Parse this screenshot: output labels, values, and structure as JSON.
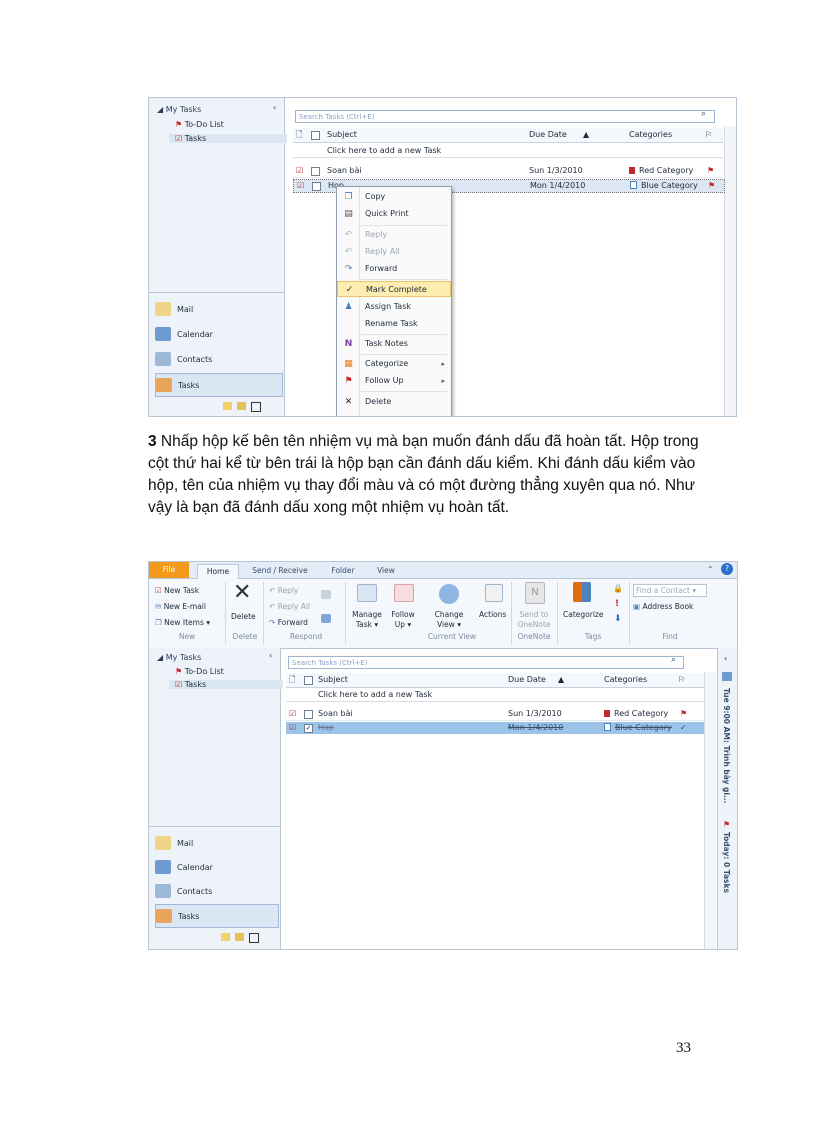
{
  "shot1": {
    "nav": {
      "header": "My Tasks",
      "items": [
        "To-Do List",
        "Tasks"
      ],
      "buttons": [
        "Mail",
        "Calendar",
        "Contacts",
        "Tasks"
      ]
    },
    "search_placeholder": "Search Tasks (Ctrl+E)",
    "columns": {
      "subject": "Subject",
      "due": "Due Date",
      "categories": "Categories"
    },
    "new_task_hint": "Click here to add a new Task",
    "tasks": [
      {
        "subject": "Soan bài",
        "due": "Sun 1/3/2010",
        "category": "Red Category",
        "cat_color": "#c4262e"
      },
      {
        "subject": "Hop",
        "due": "Mon 1/4/2010",
        "category": "Blue Category",
        "cat_color": "#4f81bd"
      }
    ],
    "context_menu": [
      {
        "label": "Copy",
        "icon": "copy-icon"
      },
      {
        "label": "Quick Print",
        "icon": "print-icon"
      },
      {
        "label": "Reply",
        "icon": "reply-icon",
        "disabled": true
      },
      {
        "label": "Reply All",
        "icon": "reply-all-icon",
        "disabled": true
      },
      {
        "label": "Forward",
        "icon": "forward-icon"
      },
      {
        "label": "Mark Complete",
        "icon": "checkmark-icon",
        "highlight": true
      },
      {
        "label": "Assign Task",
        "icon": "assign-icon"
      },
      {
        "label": "Rename Task",
        "icon": ""
      },
      {
        "label": "Task Notes",
        "icon": "onenote-icon"
      },
      {
        "label": "Categorize",
        "icon": "categorize-icon",
        "submenu": true
      },
      {
        "label": "Follow Up",
        "icon": "flag-icon",
        "submenu": true
      },
      {
        "label": "Delete",
        "icon": "delete-icon"
      }
    ]
  },
  "paragraph": {
    "number": "3",
    "text": " Nhấp hộp kế bên tên nhiệm vụ mà bạn muốn đánh dấu đã hoàn tất. Hộp trong cột thứ hai kể từ bên trái là hộp bạn cần đánh dấu kiểm. Khi đánh dấu kiểm vào hộp, tên của nhiệm vụ thay đổi màu và có một đường thẳng xuyên qua nó. Như vậy là bạn đã đánh dấu xong một nhiệm vụ hoàn tất."
  },
  "shot2": {
    "tabs": [
      "File",
      "Home",
      "Send / Receive",
      "Folder",
      "View"
    ],
    "ribbon": {
      "new_task": "New Task",
      "new_email": "New E-mail",
      "new_items": "New Items ▾",
      "delete": "Delete",
      "reply": "Reply",
      "reply_all": "Reply All",
      "forward": "Forward",
      "manage_task": "Manage Task ▾",
      "follow_up": "Follow Up ▾",
      "change_view": "Change View ▾",
      "actions": "Actions",
      "send_onenote": "Send to OneNote",
      "categorize": "Categorize",
      "find_contact": "Find a Contact ▾",
      "address_book": "Address Book",
      "groups": [
        "New",
        "Delete",
        "Respond",
        "Current View",
        "OneNote",
        "Tags",
        "Find"
      ]
    },
    "nav": {
      "header": "My Tasks",
      "items": [
        "To-Do List",
        "Tasks"
      ],
      "buttons": [
        "Mail",
        "Calendar",
        "Contacts",
        "Tasks"
      ]
    },
    "search_placeholder": "Search Tasks (Ctrl+E)",
    "columns": {
      "subject": "Subject",
      "due": "Due Date",
      "categories": "Categories"
    },
    "new_task_hint": "Click here to add a new Task",
    "tasks": [
      {
        "subject": "Soan bài",
        "due": "Sun 1/3/2010",
        "category": "Red Category",
        "cat_color": "#c4262e"
      },
      {
        "subject": "Hop",
        "due": "Mon 1/4/2010",
        "category": "Blue Category",
        "cat_color": "#4f81bd"
      }
    ],
    "todo_bar": {
      "appointment": "Tue 9:00 AM: Trình bày gi...",
      "today": "Today: 0 Tasks"
    }
  },
  "page_number": "33"
}
